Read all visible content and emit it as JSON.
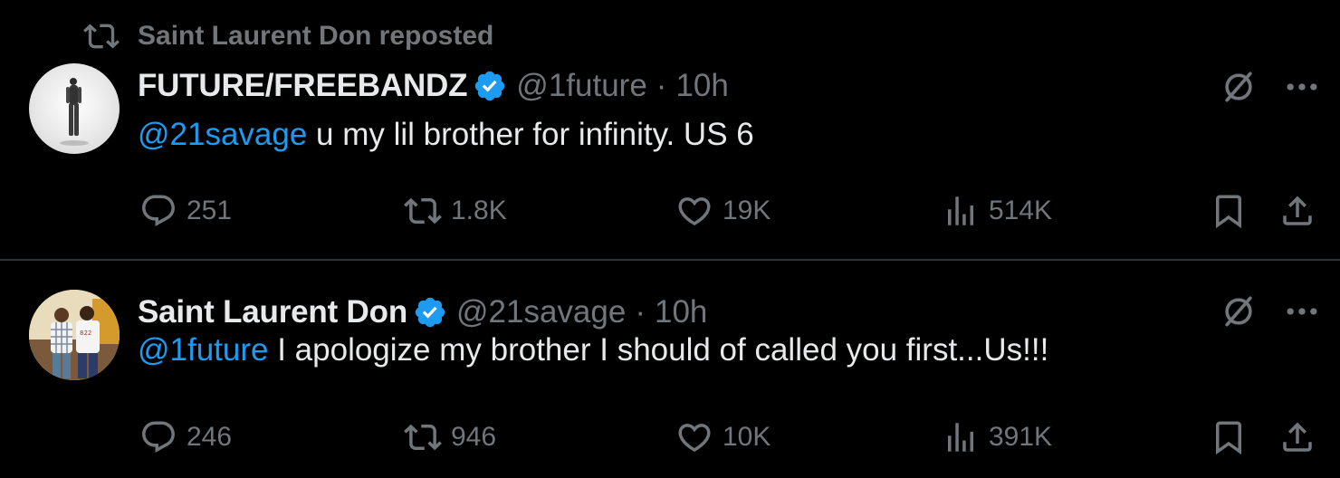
{
  "colors": {
    "background": "#000000",
    "text_primary": "#e7e9ea",
    "text_secondary": "#71767b",
    "accent": "#1d9bf0",
    "divider": "#2f3336"
  },
  "social_context": {
    "icon": "repost-icon",
    "text": "Saint Laurent Don reposted"
  },
  "tweets": [
    {
      "display_name": "FUTURE/FREEBANDZ",
      "verified": true,
      "handle": "@1future",
      "separator": "·",
      "time": "10h",
      "mention": "@21savage",
      "text": " u my lil brother for infinity. US 6",
      "stats": {
        "replies": "251",
        "reposts": "1.8K",
        "likes": "19K",
        "views": "514K"
      }
    },
    {
      "display_name": "Saint Laurent Don",
      "verified": true,
      "handle": "@21savage",
      "separator": "·",
      "time": "10h",
      "mention": "@1future",
      "text": " I apologize my brother I should of called you first...Us!!!",
      "stats": {
        "replies": "246",
        "reposts": "946",
        "likes": "10K",
        "views": "391K"
      }
    }
  ],
  "icons": [
    "repost-icon",
    "verified-badge-icon",
    "grok-icon",
    "more-icon",
    "reply-icon",
    "like-icon",
    "views-icon",
    "bookmark-icon",
    "share-icon"
  ]
}
